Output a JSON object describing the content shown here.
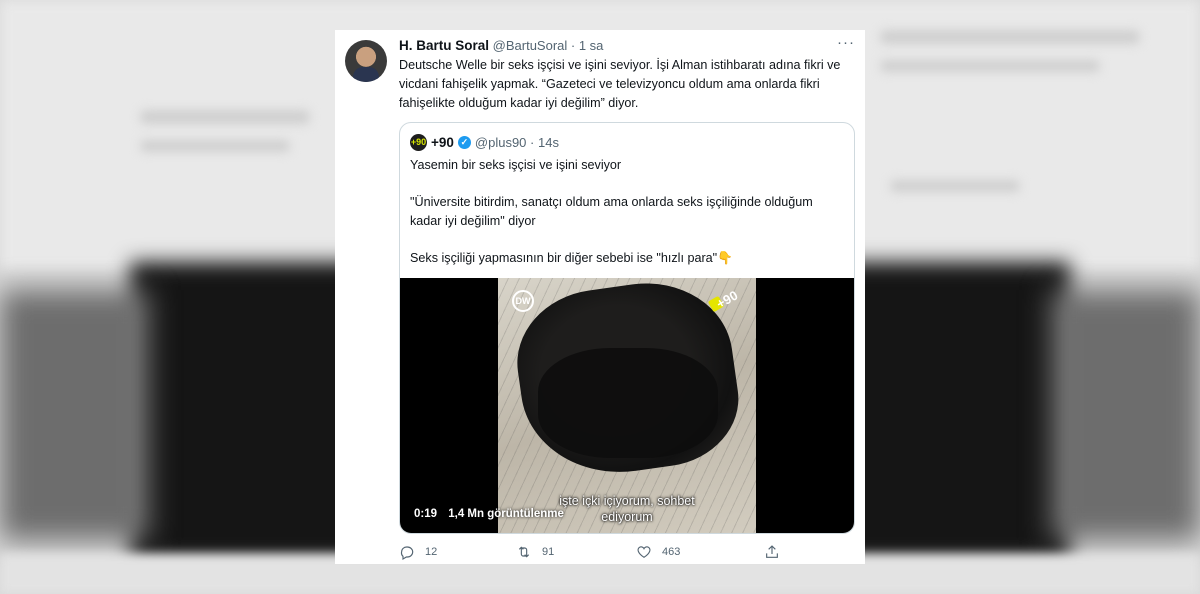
{
  "tweet": {
    "author_name": "H. Bartu Soral",
    "handle": "@BartuSoral",
    "separator": " · ",
    "time": "1 sa",
    "more_label": "···",
    "text": "Deutsche Welle bir seks işçisi ve işini seviyor. İşi Alman istihbaratı adına fikri ve vicdani fahişelik yapmak. “Gazeteci ve televizyoncu oldum ama onlarda fikri fahişelikte olduğum kadar iyi değilim” diyor."
  },
  "quote": {
    "logo_text": "+90",
    "name": "+90",
    "verified_icon": "verified-badge",
    "handle": "@plus90",
    "separator": " · ",
    "time": "14s",
    "paragraphs": [
      "Yasemin bir seks işçisi ve işini seviyor",
      "\"Üniversite bitirdim, sanatçı oldum ama onlarda seks işçiliğinde olduğum kadar iyi değilim\" diyor",
      "Seks işçiliği yapmasının bir diğer sebebi ise \"hızlı para\"👇"
    ],
    "video": {
      "dw_logo": "DW",
      "plus90_logo": "+90",
      "duration": "0:19",
      "views": "1,4 Mn görüntülenme",
      "subtitle": "işte içki içiyorum, sohbet ediyorum"
    }
  },
  "actions": {
    "reply_count": "12",
    "retweet_count": "91",
    "like_count": "463"
  }
}
